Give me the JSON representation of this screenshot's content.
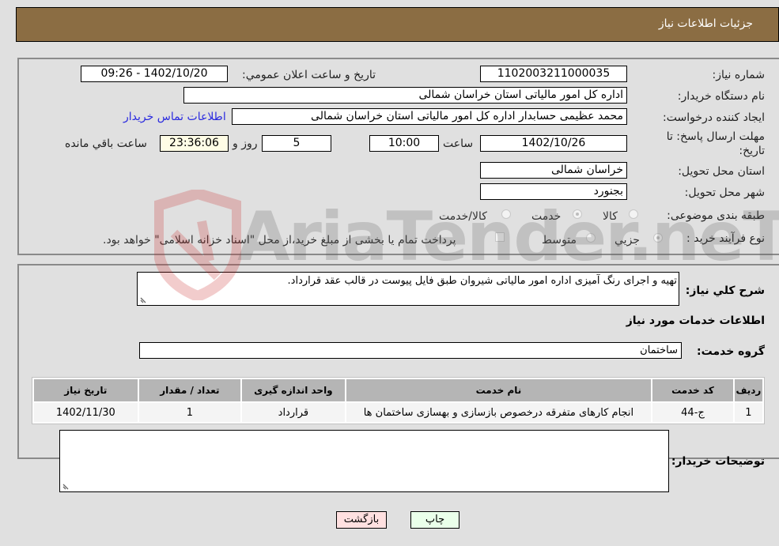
{
  "header": {
    "title": "جزئیات اطلاعات نیاز"
  },
  "details": {
    "need_number": {
      "label": "شماره نیاز:",
      "value": "1102003211000035"
    },
    "announce_datetime": {
      "label": "تاریخ و ساعت اعلان عمومي:",
      "value": "1402/10/20 - 09:26"
    },
    "buyer_org": {
      "label": "نام دستگاه خریدار:",
      "value": "اداره کل امور مالیاتی استان خراسان شمالی"
    },
    "requester": {
      "label": "ایجاد کننده درخواست:",
      "value": "محمد عظیمی حسابدار اداره کل امور مالیاتی استان خراسان شمالی"
    },
    "buyer_contact_link": "اطلاعات تماس خریدار",
    "deadline": {
      "label": "مهلت ارسال پاسخ: تا تاریخ:",
      "date": "1402/10/26",
      "time_label": "ساعت",
      "time": "10:00",
      "days": "5",
      "days_label": "روز و",
      "remaining": "23:36:06",
      "remaining_label": "ساعت باقي مانده"
    },
    "delivery_province": {
      "label": "استان محل تحویل:",
      "value": "خراسان شمالی"
    },
    "delivery_city": {
      "label": "شهر محل تحویل:",
      "value": "بجنورد"
    },
    "category": {
      "label": "طبقه بندی موضوعی:",
      "options": [
        "کالا",
        "خدمت",
        "کالا/خدمت"
      ],
      "selected": "خدمت"
    },
    "purchase_process": {
      "label": "نوع فرآیند خرید :",
      "options": [
        "جزيي",
        "متوسط"
      ],
      "selected": "جزيي",
      "treasury_note": "پرداخت تمام یا بخشی از مبلغ خرید،از محل \"اسناد خزانه اسلامی\" خواهد بود."
    }
  },
  "need": {
    "summary_label": "شرح كلي نياز:",
    "summary": "تهیه و اجرای رنگ آمیزی اداره امور مالیاتی شیروان طبق فایل پیوست در قالب عقد قرارداد.",
    "services_title": "اطلاعات خدمات مورد نیاز",
    "service_group_label": "گروه خدمت:",
    "service_group": "ساختمان"
  },
  "table": {
    "headers": [
      "ردیف",
      "کد خدمت",
      "نام خدمت",
      "واحد اندازه گیری",
      "تعداد / مقدار",
      "تاریخ نیاز"
    ],
    "rows": [
      [
        "1",
        "ج-44",
        "انجام کارهای متفرقه درخصوص بازسازی و بهسازی ساختمان ها",
        "قرارداد",
        "1",
        "1402/11/30"
      ]
    ]
  },
  "buyer_notes": {
    "label": "توضیحات خریدار:",
    "value": ""
  },
  "buttons": {
    "print": "چاپ",
    "back": "بازگشت"
  },
  "watermark": "AriaTender.neT"
}
